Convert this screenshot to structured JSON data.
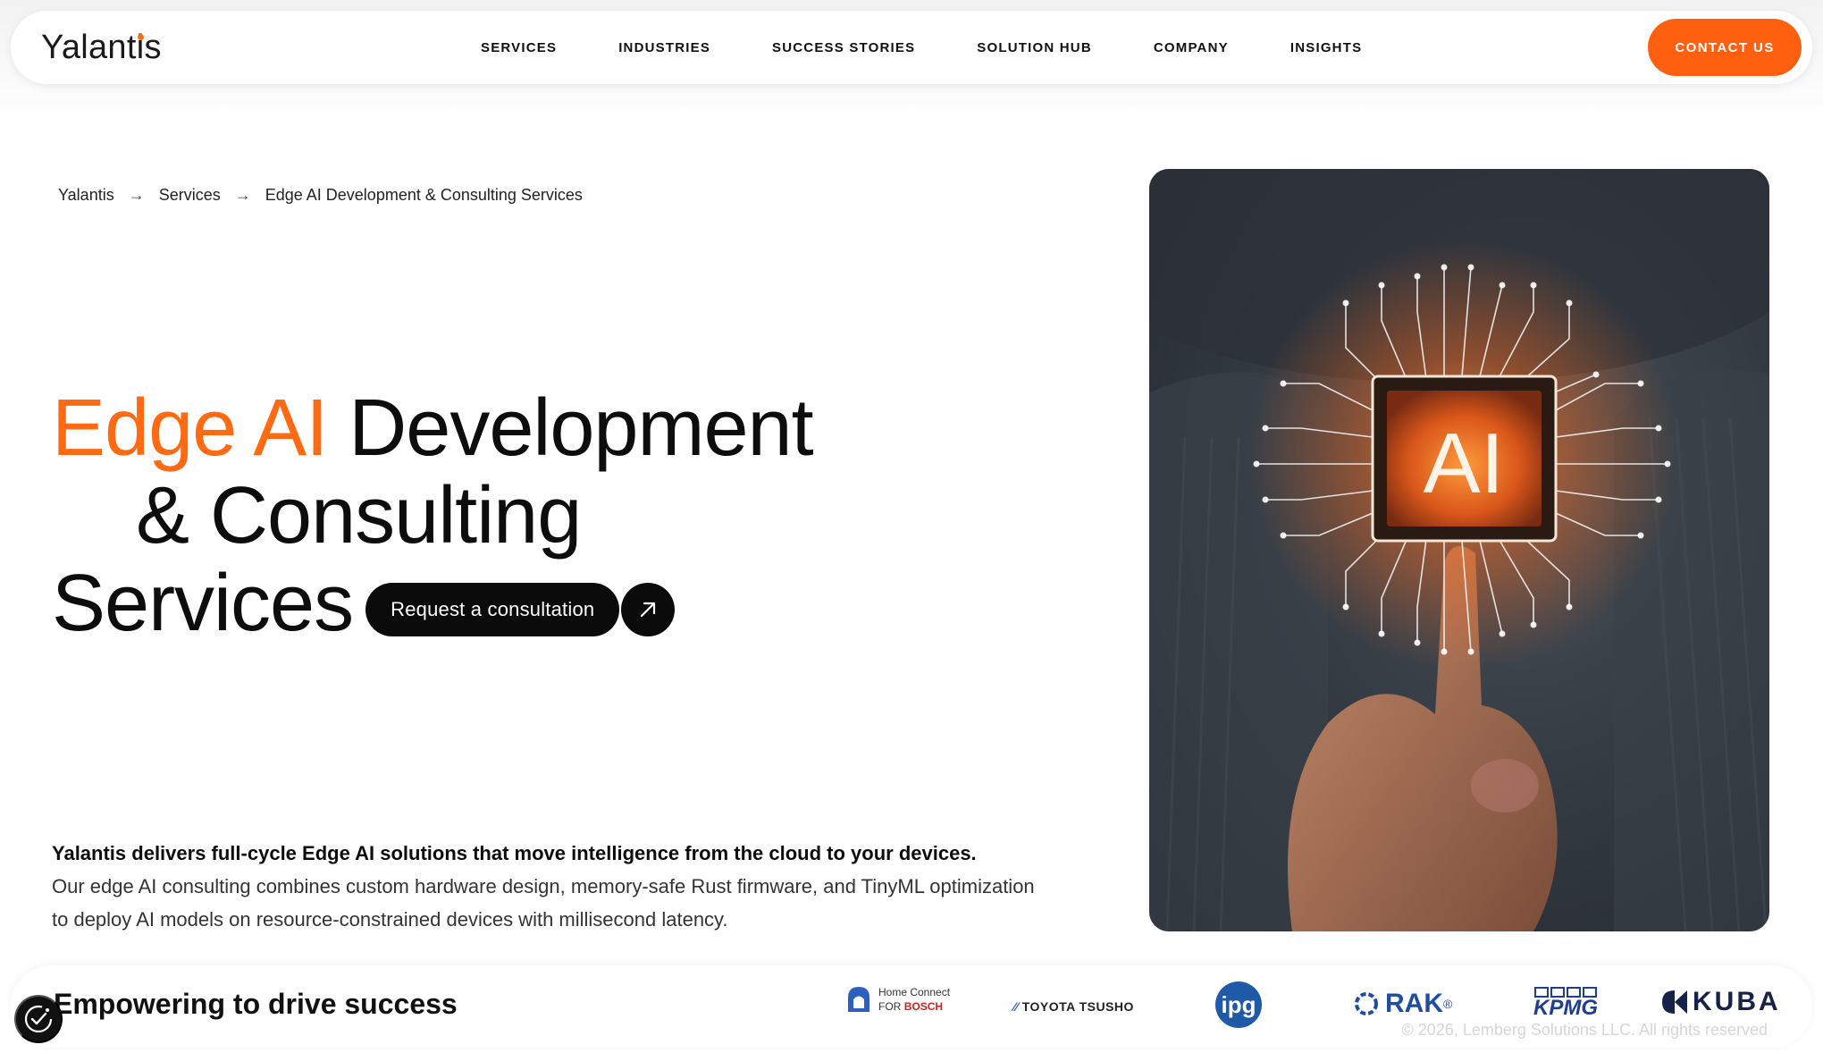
{
  "brand": {
    "name_start": "Yalan",
    "name_i": "i",
    "name_end": "s",
    "name_t": "t",
    "accent": "#ff6010"
  },
  "nav": {
    "items": [
      {
        "label": "SERVICES"
      },
      {
        "label": "INDUSTRIES"
      },
      {
        "label": "SUCCESS STORIES"
      },
      {
        "label": "SOLUTION HUB"
      },
      {
        "label": "COMPANY"
      },
      {
        "label": "INSIGHTS"
      }
    ],
    "contact_label": "CONTACT US"
  },
  "breadcrumb": {
    "items": [
      "Yalantis",
      "Services",
      "Edge AI Development & Consulting Services"
    ],
    "separator": "→"
  },
  "hero": {
    "title_orange": "Edge AI",
    "title_rest_1": "Development",
    "title_line_2": "& Consulting",
    "title_line_3": "Services",
    "cta_label": "Request a consultation",
    "image_chip_label": "AI",
    "description_lead": "Yalantis delivers full-cycle Edge AI solutions that move intelligence from the cloud to your devices.",
    "description_body": "Our edge AI consulting combines custom hardware design, memory-safe Rust firmware, and TinyML optimization to deploy AI models on resource-constrained devices with millisecond latency."
  },
  "clients": {
    "heading": "Empowering to drive success",
    "logos": [
      {
        "name": "Home Connect for Bosch",
        "line1": "Home Connect",
        "line2a": "FOR",
        "line2b": "BOSCH"
      },
      {
        "name": "Toyota Tsusho",
        "text": "TOYOTA TSUSHO"
      },
      {
        "name": "ipg",
        "text": "ipg"
      },
      {
        "name": "RAK",
        "text": "RAK",
        "mark": "®"
      },
      {
        "name": "KPMG",
        "text": "KPMG"
      },
      {
        "name": "KUBA",
        "text": "KUBA"
      }
    ],
    "copyright": "© 2026, Lemberg Solutions LLC. All rights reserved"
  },
  "icons": {
    "cta_arrow": "arrow-up-right-icon",
    "cookie": "cookie-settings-icon"
  }
}
